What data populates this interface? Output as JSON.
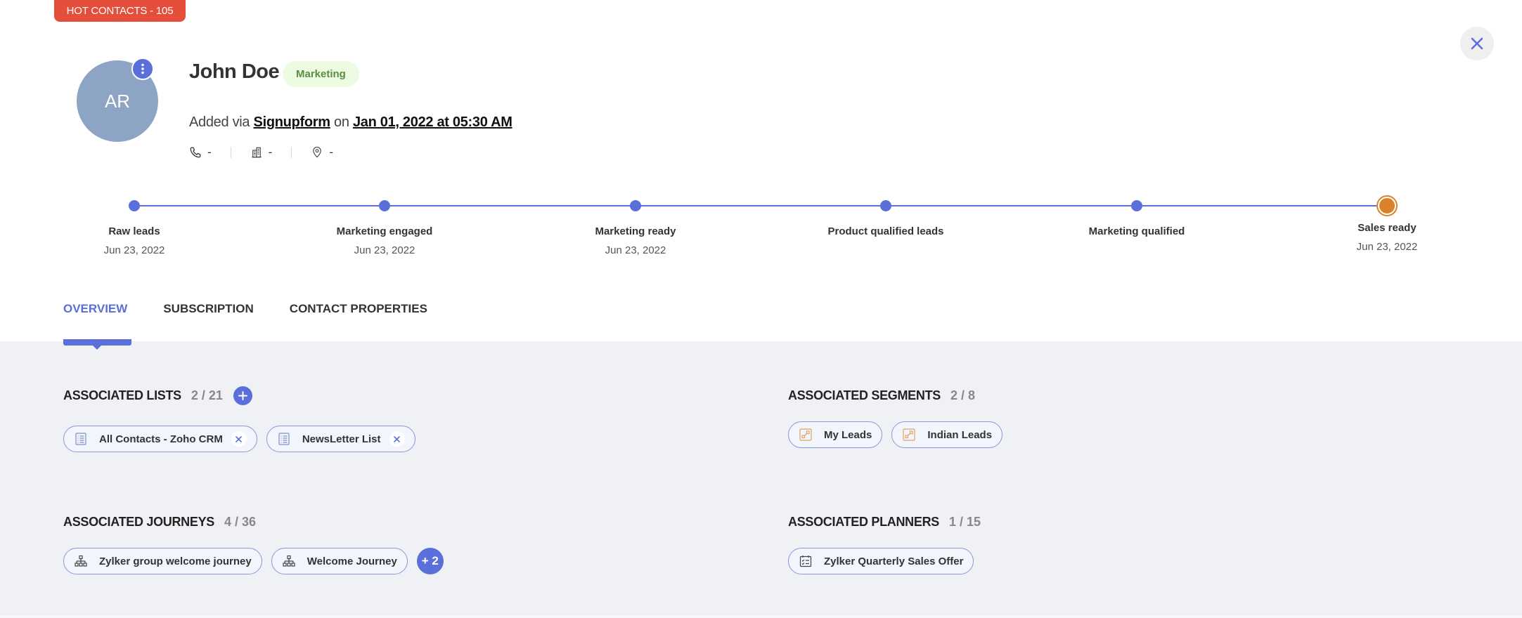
{
  "badge": {
    "label": "HOT CONTACTS - 105"
  },
  "contact": {
    "initials": "AR",
    "name": "John Doe",
    "tag": "Marketing",
    "added_prefix": "Added via",
    "source": "Signupform",
    "added_mid": "on",
    "added_date": "Jan 01, 2022 at 05:30 AM",
    "phone": "-",
    "company": "-",
    "location": "-"
  },
  "timeline": {
    "stages": [
      {
        "label": "Raw leads",
        "date": "Jun 23, 2022",
        "current": false
      },
      {
        "label": "Marketing engaged",
        "date": "Jun 23, 2022",
        "current": false
      },
      {
        "label": "Marketing ready",
        "date": "Jun 23, 2022",
        "current": false
      },
      {
        "label": "Product qualified leads",
        "date": "",
        "current": false
      },
      {
        "label": "Marketing qualified",
        "date": "",
        "current": false
      },
      {
        "label": "Sales ready",
        "date": "Jun 23, 2022",
        "current": true
      }
    ]
  },
  "tabs": [
    {
      "label": "OVERVIEW",
      "active": true
    },
    {
      "label": "SUBSCRIPTION",
      "active": false
    },
    {
      "label": "CONTACT PROPERTIES",
      "active": false
    }
  ],
  "sections": {
    "lists": {
      "title": "ASSOCIATED LISTS",
      "count": "2 / 21",
      "items": [
        "All Contacts - Zoho CRM",
        "NewsLetter List"
      ]
    },
    "segments": {
      "title": "ASSOCIATED SEGMENTS",
      "count": "2 / 8",
      "items": [
        "My Leads",
        "Indian Leads"
      ]
    },
    "journeys": {
      "title": "ASSOCIATED JOURNEYS",
      "count": "4 / 36",
      "items": [
        "Zylker group welcome journey",
        "Welcome Journey"
      ],
      "more": "+ 2"
    },
    "planners": {
      "title": "ASSOCIATED PLANNERS",
      "count": "1 / 15",
      "items": [
        "Zylker Quarterly Sales Offer"
      ]
    }
  },
  "colors": {
    "accent": "#5b6fdb",
    "hot_badge": "#e54e3a",
    "current_stage": "#d9822b",
    "tag_bg": "#eefbe3",
    "tag_text": "#5b8d3d",
    "content_bg": "#eff1f4"
  }
}
